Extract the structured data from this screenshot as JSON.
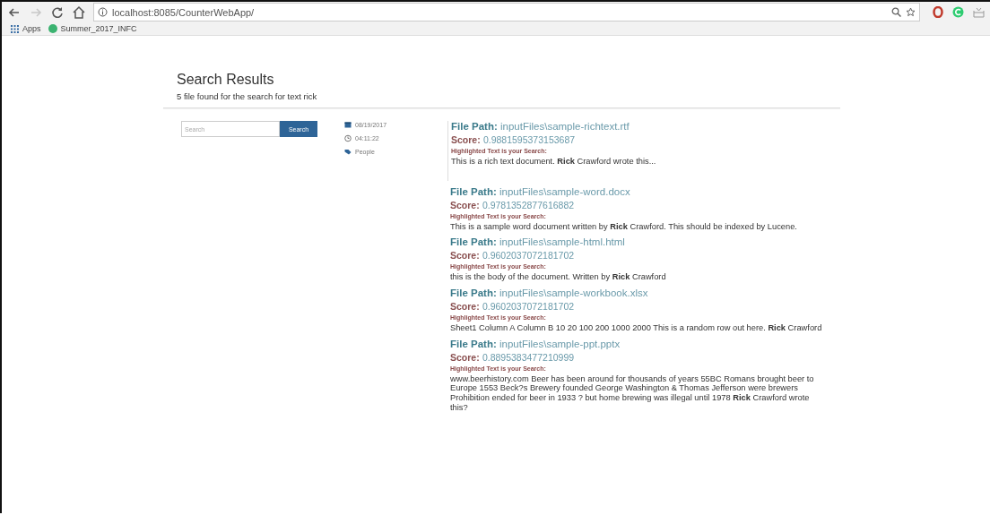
{
  "browser": {
    "nav_buttons": [
      {
        "kind": "back",
        "disabled": false
      },
      {
        "kind": "forward",
        "disabled": true
      },
      {
        "kind": "reload",
        "disabled": false
      },
      {
        "kind": "home",
        "disabled": false
      }
    ],
    "url": "localhost:8085/CounterWebApp/",
    "bookmarks": [
      {
        "kind": "apps",
        "label": "Apps"
      },
      {
        "kind": "site",
        "label": "Summer_2017_INFC"
      }
    ]
  },
  "page": {
    "title": "Search Results",
    "subtitle": "5 file found for the search for text rick",
    "search": {
      "placeholder": "Search",
      "button": "Search"
    },
    "meta": [
      {
        "kind": "date",
        "text": "08/19/2017"
      },
      {
        "kind": "time",
        "text": "04:11:22"
      },
      {
        "kind": "tag",
        "text": "People"
      }
    ],
    "results": [
      {
        "path_label": "File Path:",
        "path": "inputFiles\\sample-richtext.rtf",
        "score_label": "Score:",
        "score": "0.9881595373153687",
        "highlight_label": "Highlighted Text is your Search:",
        "text": "This is a rich text document. **Rick** Crawford wrote this..."
      },
      {
        "path_label": "File Path:",
        "path": "inputFiles\\sample-word.docx",
        "score_label": "Score:",
        "score": "0.9781352877616882",
        "highlight_label": "Highlighted Text is your Search:",
        "text": "This is a sample word document written by **Rick** Crawford. This should be indexed by Lucene."
      },
      {
        "path_label": "File Path:",
        "path": "inputFiles\\sample-html.html",
        "score_label": "Score:",
        "score": "0.9602037072181702",
        "highlight_label": "Highlighted Text is your Search:",
        "text": "this is the body of the document. Written by **Rick** Crawford"
      },
      {
        "path_label": "File Path:",
        "path": "inputFiles\\sample-workbook.xlsx",
        "score_label": "Score:",
        "score": "0.9602037072181702",
        "highlight_label": "Highlighted Text is your Search:",
        "text": "Sheet1 Column A Column B 10 20 100 200 1000 2000 This is a random row out here. **Rick** Crawford"
      },
      {
        "path_label": "File Path:",
        "path": "inputFiles\\sample-ppt.pptx",
        "score_label": "Score:",
        "score": "0.8895383477210999",
        "highlight_label": "Highlighted Text is your Search:",
        "text": "www.beerhistory.com Beer has been around for thousands of years 55BC Romans brought beer to Europe 1553 Beck?s Brewery founded George Washington & Thomas Jefferson were brewers Prohibition ended for beer in 1933 ? but home brewing was illegal until 1978 **Rick** Crawford wrote this?"
      }
    ]
  }
}
